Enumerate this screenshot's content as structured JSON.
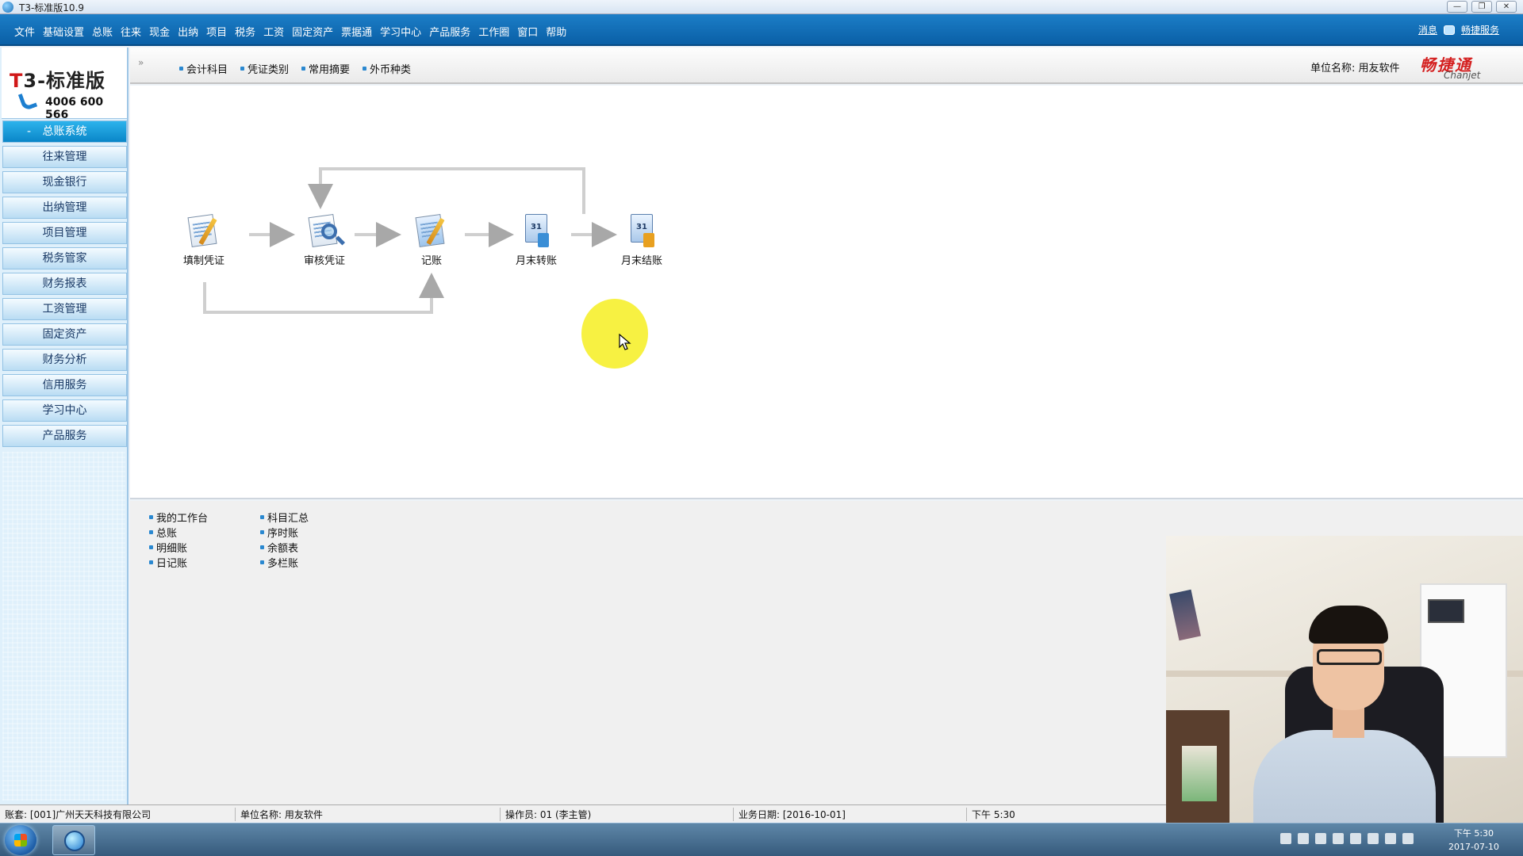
{
  "window": {
    "title": "T3-标准版10.9",
    "controls": [
      "—",
      "❐",
      "✕"
    ]
  },
  "menubar": {
    "items": [
      "文件",
      "基础设置",
      "总账",
      "往来",
      "现金",
      "出纳",
      "项目",
      "税务",
      "工资",
      "固定资产",
      "票据通",
      "学习中心",
      "产品服务",
      "工作圈",
      "窗口",
      "帮助"
    ],
    "right_msg": "消息",
    "right_link": "畅捷服务"
  },
  "logo": {
    "title_prefix": "T",
    "title_rest": "3-标准版",
    "phone": "4006 600 566"
  },
  "sidebar": {
    "items": [
      "总账系统",
      "往来管理",
      "现金银行",
      "出纳管理",
      "项目管理",
      "税务管家",
      "财务报表",
      "工资管理",
      "固定资产",
      "财务分析",
      "信用服务",
      "学习中心",
      "产品服务"
    ],
    "active_marker": "-"
  },
  "toolbar": {
    "collapse": "»",
    "links": [
      "会计科目",
      "凭证类别",
      "常用摘要",
      "外币种类"
    ],
    "unit_label": "单位名称: 用友软件",
    "brand_cn": "畅捷通",
    "brand_en": "Chanjet"
  },
  "flow": {
    "nodes": [
      "填制凭证",
      "审核凭证",
      "记账",
      "月末转账",
      "月末结账"
    ]
  },
  "quick_links": {
    "col1": [
      "我的工作台",
      "总账",
      "明细账",
      "日记账"
    ],
    "col2": [
      "科目汇总",
      "序时账",
      "余额表",
      "多栏账"
    ]
  },
  "statusbar": {
    "account": "账套: [001]广州天天科技有限公司",
    "unit": "单位名称: 用友软件",
    "operator": "操作员: 01 (李主管)",
    "biz_date": "业务日期: [2016-10-01]",
    "time": "下午 5:30"
  },
  "taskbar": {
    "clock_time": "下午 5:30",
    "clock_date": "2017-07-10"
  },
  "colors": {
    "menubar": "#0a5fa6",
    "sidebar_active": "#0a86c8",
    "brand_red": "#d42020",
    "cursor_highlight": "#f6f032"
  }
}
